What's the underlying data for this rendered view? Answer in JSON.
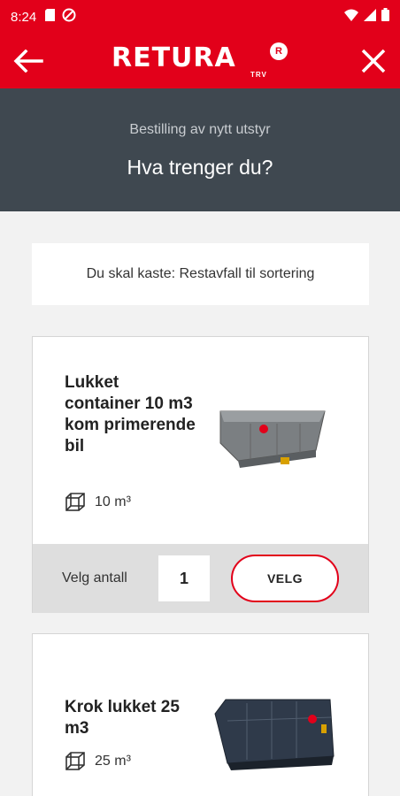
{
  "status_bar": {
    "time": "8:24",
    "icons": [
      "sim-card-icon",
      "do-not-disturb-icon",
      "wifi-icon",
      "signal-icon",
      "battery-icon"
    ]
  },
  "app_bar": {
    "logo_text": "RETURA",
    "logo_sub": "TRV",
    "logo_badge": "R",
    "back_icon": "arrow-left-icon",
    "close_icon": "close-icon"
  },
  "header": {
    "subtitle": "Bestilling av nytt utstyr",
    "title": "Hva trenger du?"
  },
  "waste_info": "Du skal kaste: Restavfall til sortering",
  "products": [
    {
      "title": "Lukket container 10 m3 kom primerende bil",
      "volume": "10 m³",
      "order_label": "Velg antall",
      "quantity": "1",
      "button_label": "VELG"
    },
    {
      "title": "Krok lukket 25 m3",
      "volume": "25 m³"
    }
  ],
  "colors": {
    "brand_red": "#e2001a",
    "header_bg": "#3f4850",
    "page_bg": "#f2f2f2"
  }
}
